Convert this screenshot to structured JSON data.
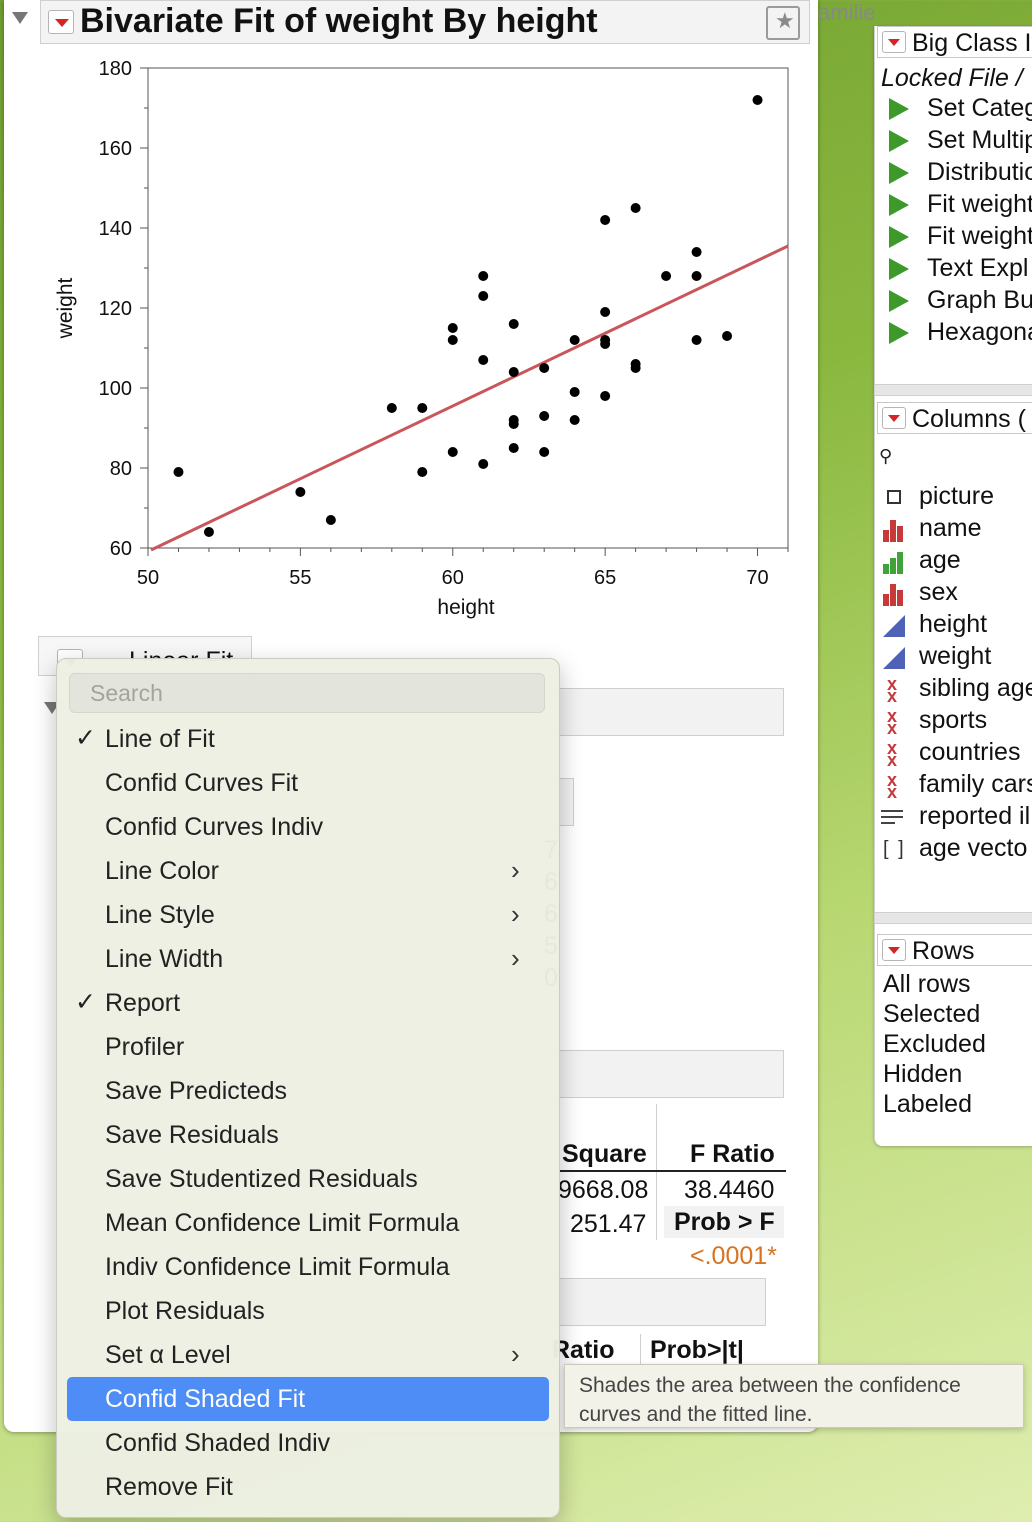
{
  "report": {
    "title": "Bivariate Fit of weight By height",
    "family_label": "amilie",
    "linear_fit_label": "Linear Fit"
  },
  "chart_data": {
    "type": "scatter",
    "title": "",
    "xlabel": "height",
    "ylabel": "weight",
    "xlim": [
      50,
      71
    ],
    "ylim": [
      60,
      180
    ],
    "x_ticks": [
      50,
      55,
      60,
      65,
      70
    ],
    "y_ticks": [
      60,
      80,
      100,
      120,
      140,
      160,
      180
    ],
    "grid": false,
    "points": [
      {
        "x": 51,
        "y": 79
      },
      {
        "x": 52,
        "y": 64
      },
      {
        "x": 55,
        "y": 74
      },
      {
        "x": 56,
        "y": 67
      },
      {
        "x": 58,
        "y": 95
      },
      {
        "x": 59,
        "y": 95
      },
      {
        "x": 59,
        "y": 79
      },
      {
        "x": 60,
        "y": 115
      },
      {
        "x": 60,
        "y": 112
      },
      {
        "x": 60,
        "y": 84
      },
      {
        "x": 61,
        "y": 128
      },
      {
        "x": 61,
        "y": 123
      },
      {
        "x": 61,
        "y": 107
      },
      {
        "x": 61,
        "y": 81
      },
      {
        "x": 62,
        "y": 116
      },
      {
        "x": 62,
        "y": 104
      },
      {
        "x": 62,
        "y": 92
      },
      {
        "x": 62,
        "y": 91
      },
      {
        "x": 62,
        "y": 85
      },
      {
        "x": 63,
        "y": 105
      },
      {
        "x": 63,
        "y": 93
      },
      {
        "x": 63,
        "y": 84
      },
      {
        "x": 64,
        "y": 112
      },
      {
        "x": 64,
        "y": 99
      },
      {
        "x": 64,
        "y": 92
      },
      {
        "x": 65,
        "y": 142
      },
      {
        "x": 65,
        "y": 119
      },
      {
        "x": 65,
        "y": 112
      },
      {
        "x": 65,
        "y": 111
      },
      {
        "x": 65,
        "y": 98
      },
      {
        "x": 66,
        "y": 145
      },
      {
        "x": 66,
        "y": 106
      },
      {
        "x": 66,
        "y": 105
      },
      {
        "x": 67,
        "y": 128
      },
      {
        "x": 68,
        "y": 134
      },
      {
        "x": 68,
        "y": 128
      },
      {
        "x": 68,
        "y": 112
      },
      {
        "x": 69,
        "y": 113
      },
      {
        "x": 70,
        "y": 172
      }
    ],
    "fit_line": {
      "x": [
        50.1,
        71
      ],
      "y": [
        59.5,
        135.5
      ],
      "color": "#c8565a"
    }
  },
  "report_fragments": {
    "col1": [
      "7",
      "6",
      "6",
      "5",
      "0"
    ],
    "square_header": "Square",
    "fratio_header": "F Ratio",
    "square_vals": [
      "9668.08",
      "251.47"
    ],
    "fratio_val": "38.4460",
    "prob_f_header": "Prob > F",
    "prob_f_val": "<.0001*",
    "ratio_header": "Ratio",
    "prob_t_header": "Prob>|t|"
  },
  "menu": {
    "search_placeholder": "Search",
    "items": [
      {
        "label": "Line of Fit",
        "checked": "✓",
        "submenu": ""
      },
      {
        "label": "Confid Curves Fit",
        "checked": "",
        "submenu": ""
      },
      {
        "label": "Confid Curves Indiv",
        "checked": "",
        "submenu": ""
      },
      {
        "label": "Line Color",
        "checked": "",
        "submenu": "›"
      },
      {
        "label": "Line Style",
        "checked": "",
        "submenu": "›"
      },
      {
        "label": "Line Width",
        "checked": "",
        "submenu": "›"
      },
      {
        "label": "Report",
        "checked": "✓",
        "submenu": ""
      },
      {
        "label": "Profiler",
        "checked": "",
        "submenu": ""
      },
      {
        "label": "Save Predicteds",
        "checked": "",
        "submenu": ""
      },
      {
        "label": "Save Residuals",
        "checked": "",
        "submenu": ""
      },
      {
        "label": "Save Studentized Residuals",
        "checked": "",
        "submenu": ""
      },
      {
        "label": "Mean Confidence Limit Formula",
        "checked": "",
        "submenu": ""
      },
      {
        "label": "Indiv Confidence Limit Formula",
        "checked": "",
        "submenu": ""
      },
      {
        "label": "Plot Residuals",
        "checked": "",
        "submenu": ""
      },
      {
        "label": "Set α Level",
        "checked": "",
        "submenu": "›"
      },
      {
        "label": "Confid Shaded Fit",
        "checked": "",
        "submenu": "",
        "highlighted": true
      },
      {
        "label": "Confid Shaded Indiv",
        "checked": "",
        "submenu": ""
      },
      {
        "label": "Remove Fit",
        "checked": "",
        "submenu": ""
      }
    ]
  },
  "tooltip": {
    "text": "Shades the area between the confidence curves and the fitted line."
  },
  "data_table": {
    "title": "Big Class I",
    "locked_file": "Locked File  /",
    "scripts": [
      "Set Categ",
      "Set Multip",
      "Distributio",
      "Fit weight",
      "Fit weight",
      "Text Expl",
      "Graph Bu",
      "Hexagona"
    ],
    "columns_header": "Columns (",
    "columns": [
      {
        "name": "picture",
        "icon": "picture-icon"
      },
      {
        "name": "name",
        "icon": "nominal-icon"
      },
      {
        "name": "age",
        "icon": "ordinal-icon"
      },
      {
        "name": "sex",
        "icon": "nominal-icon"
      },
      {
        "name": "height",
        "icon": "continuous-icon"
      },
      {
        "name": "weight",
        "icon": "continuous-icon"
      },
      {
        "name": "sibling age",
        "icon": "multiple-response-icon"
      },
      {
        "name": "sports",
        "icon": "multiple-response-icon"
      },
      {
        "name": "countries",
        "icon": "multiple-response-icon"
      },
      {
        "name": "family cars",
        "icon": "multiple-response-icon"
      },
      {
        "name": "reported il",
        "icon": "unstructured-text-icon"
      },
      {
        "name": "age vecto",
        "icon": "vector-icon"
      }
    ],
    "rows_header": "Rows",
    "rows": [
      "All rows",
      "Selected",
      "Excluded",
      "Hidden",
      "Labeled"
    ]
  }
}
